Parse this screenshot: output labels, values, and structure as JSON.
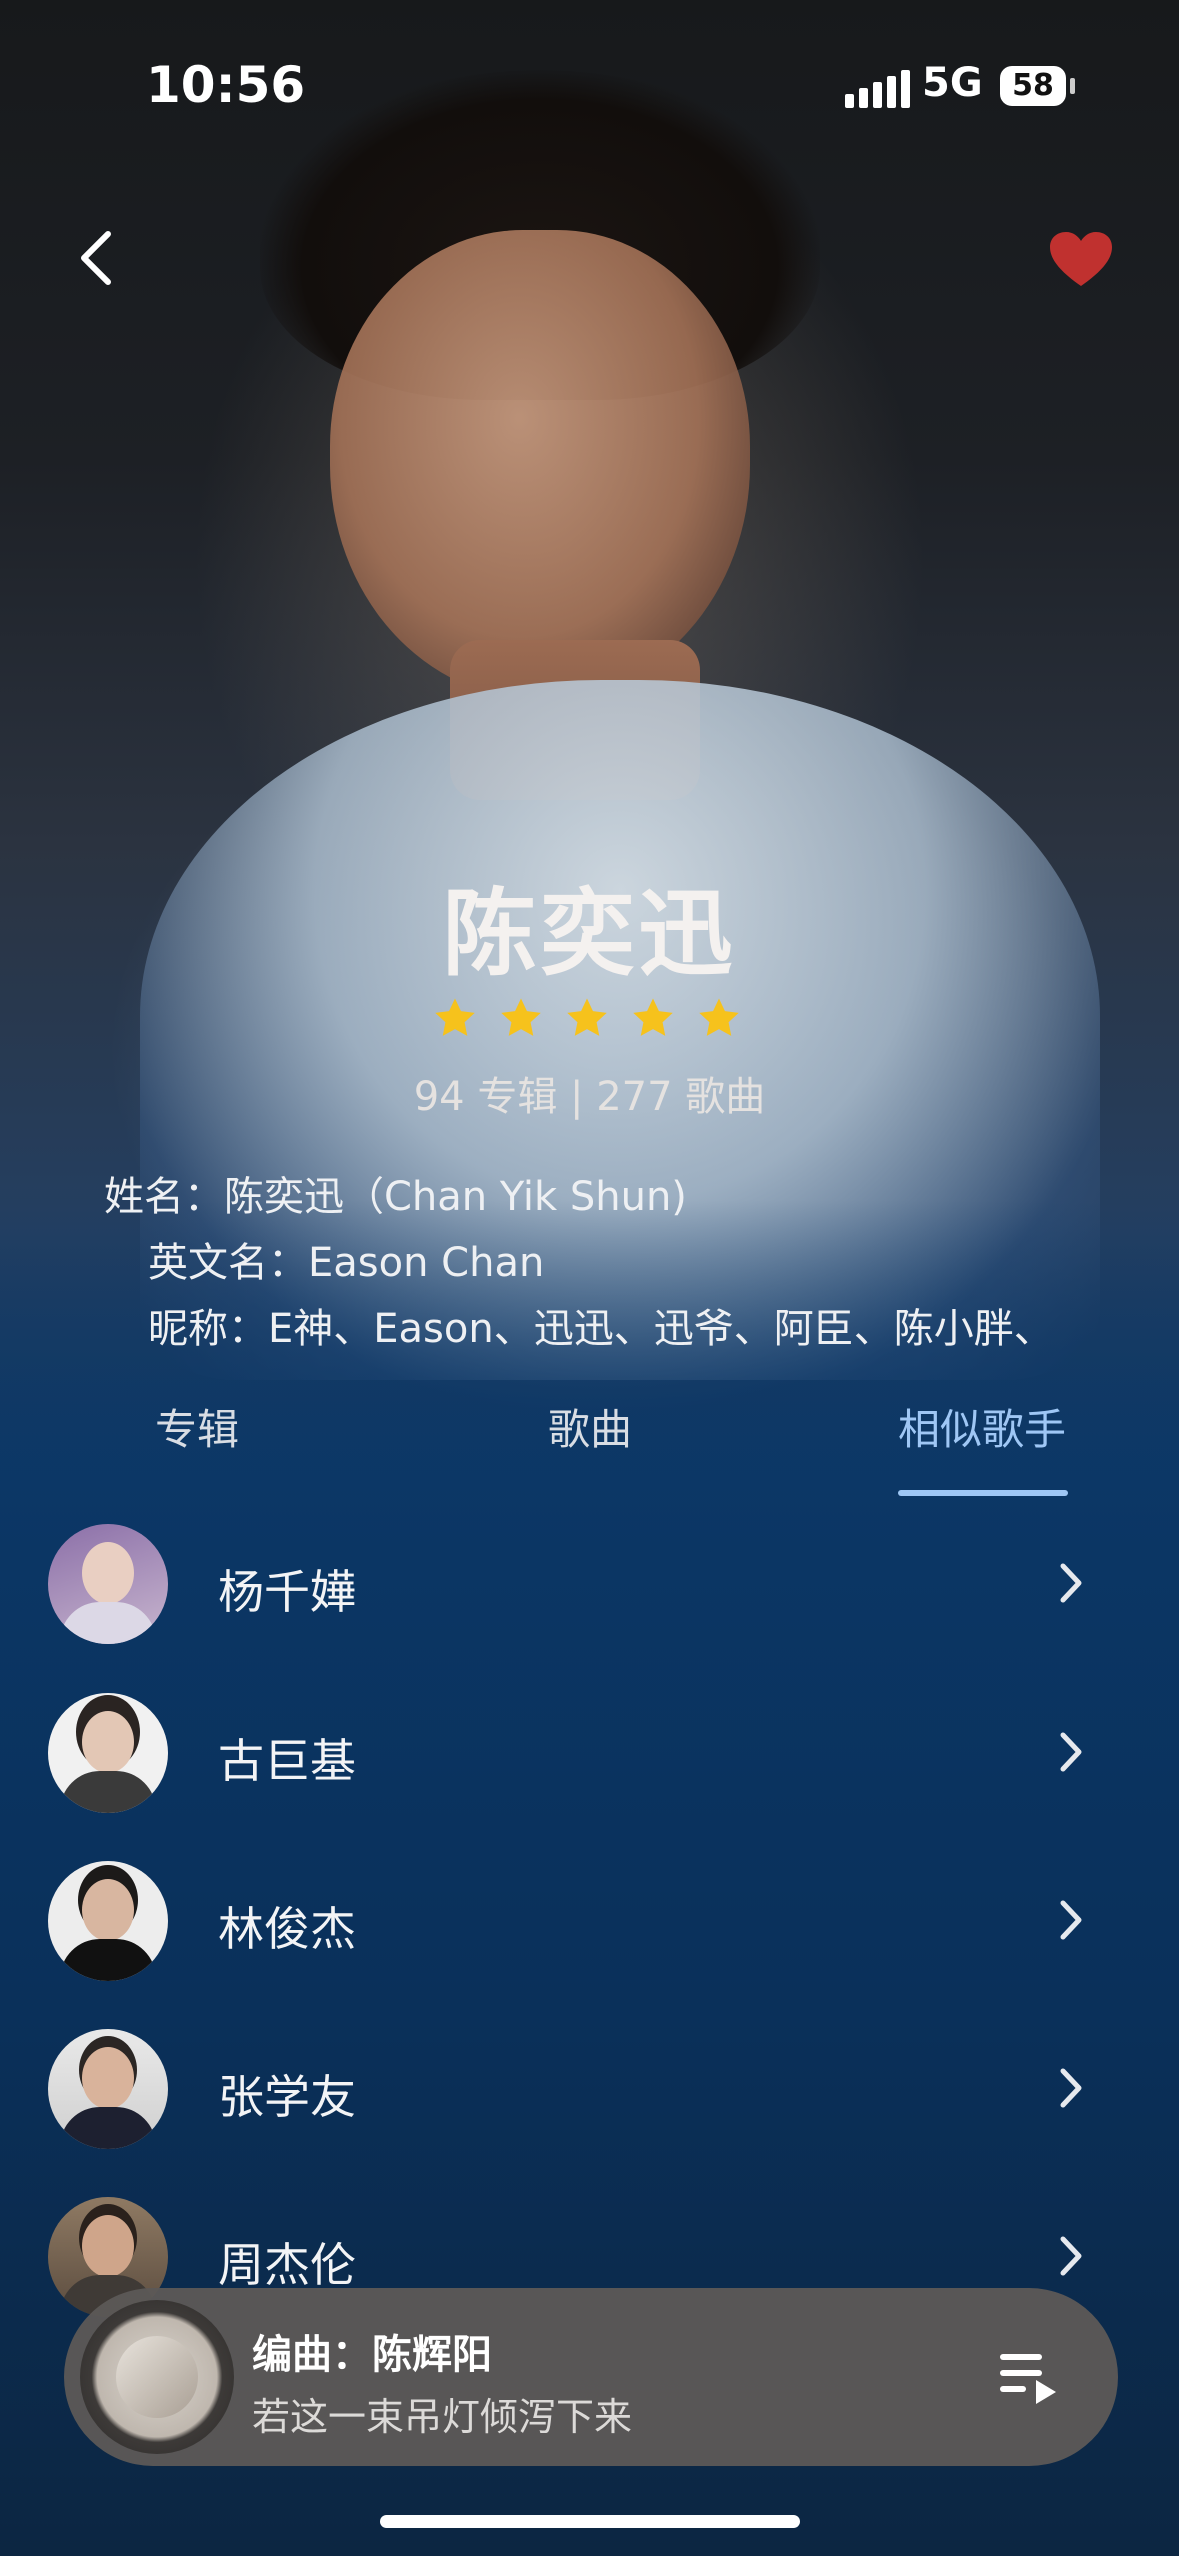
{
  "status_bar": {
    "time": "10:56",
    "network": "5G",
    "battery": "58"
  },
  "artist": {
    "name": "陈奕迅",
    "rating_stars": 5,
    "stats": "94 专辑 | 277 歌曲",
    "full_name": "姓名：陈奕迅（Chan Yik Shun)",
    "english_name": "英文名：Eason Chan",
    "nicknames": "昵称：E神、Eason、迅迅、迅爷、阿臣、陈小胖、"
  },
  "tabs": [
    {
      "label": "专辑"
    },
    {
      "label": "歌曲"
    },
    {
      "label": "相似歌手",
      "active": true
    }
  ],
  "similar_artists": [
    {
      "name": "杨千嬅"
    },
    {
      "name": "古巨基"
    },
    {
      "name": "林俊杰"
    },
    {
      "name": "张学友"
    },
    {
      "name": "周杰伦"
    }
  ],
  "now_playing": {
    "title": "编曲：陈辉阳",
    "subtitle": "若这一束吊灯倾泻下来"
  },
  "colors": {
    "accent": "#9fc7f5",
    "star": "#f6c21c",
    "heart": "#c0312f"
  }
}
